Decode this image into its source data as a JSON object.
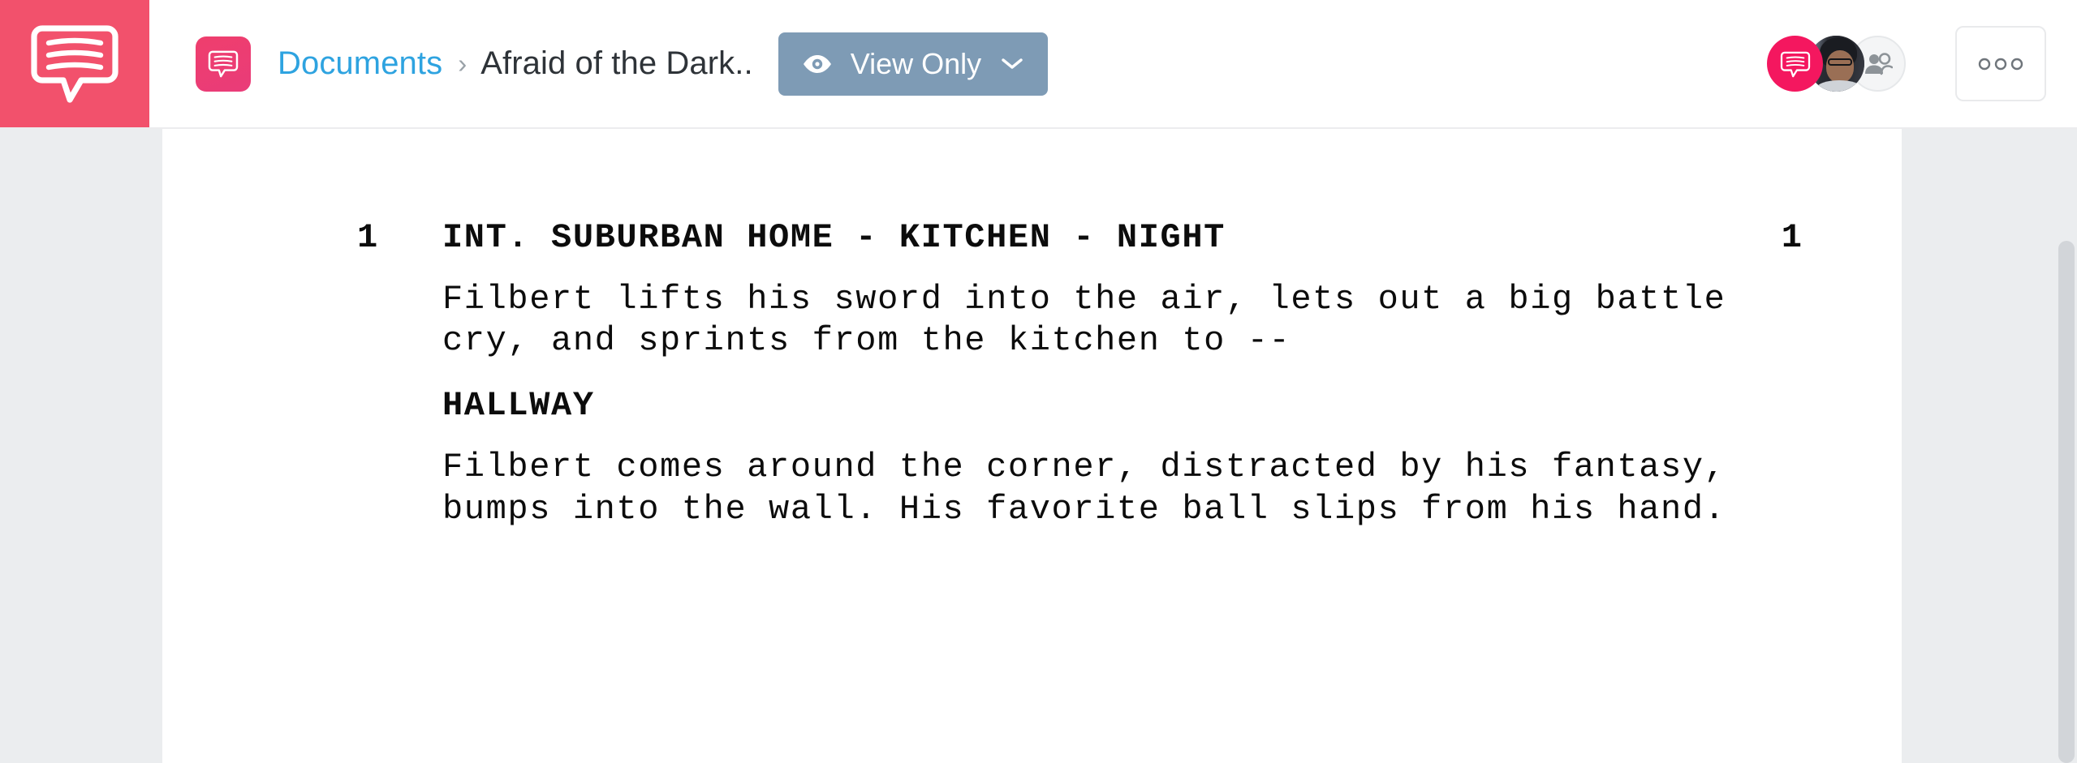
{
  "app": {
    "brand_icon": "speech-bubble-logo",
    "accent_pink": "#f2516c",
    "chip_pink": "#ef3e6d",
    "link_blue": "#2ea3e0",
    "view_button_bg": "#7e9bb5"
  },
  "header": {
    "doc_chip_icon": "document-speech-bubble-icon",
    "breadcrumb": {
      "root_label": "Documents",
      "separator": "›",
      "current_label": "Afraid of the Dark.."
    },
    "view_mode_button": {
      "label": "View Only",
      "eye_icon": "eye-icon",
      "chevron_icon": "chevron-down-icon"
    },
    "avatars": [
      {
        "name": "app-logo-avatar",
        "type": "logo"
      },
      {
        "name": "user-photo-avatar",
        "type": "photo"
      },
      {
        "name": "add-collaborator-avatar",
        "type": "people-icon"
      }
    ],
    "more_button": {
      "label": "○○○",
      "icon": "ellipsis-icon"
    }
  },
  "document": {
    "scene_number_left": "1",
    "scene_number_right": "1",
    "scene_heading": "INT. SUBURBAN HOME - KITCHEN - NIGHT",
    "action_1": "Filbert lifts his sword into the air, lets out a big battle\ncry, and sprints from the kitchen to --",
    "slug_1": "HALLWAY",
    "action_2": "Filbert comes around the corner, distracted by his fantasy,\nbumps into the wall. His favorite ball slips from his hand."
  }
}
